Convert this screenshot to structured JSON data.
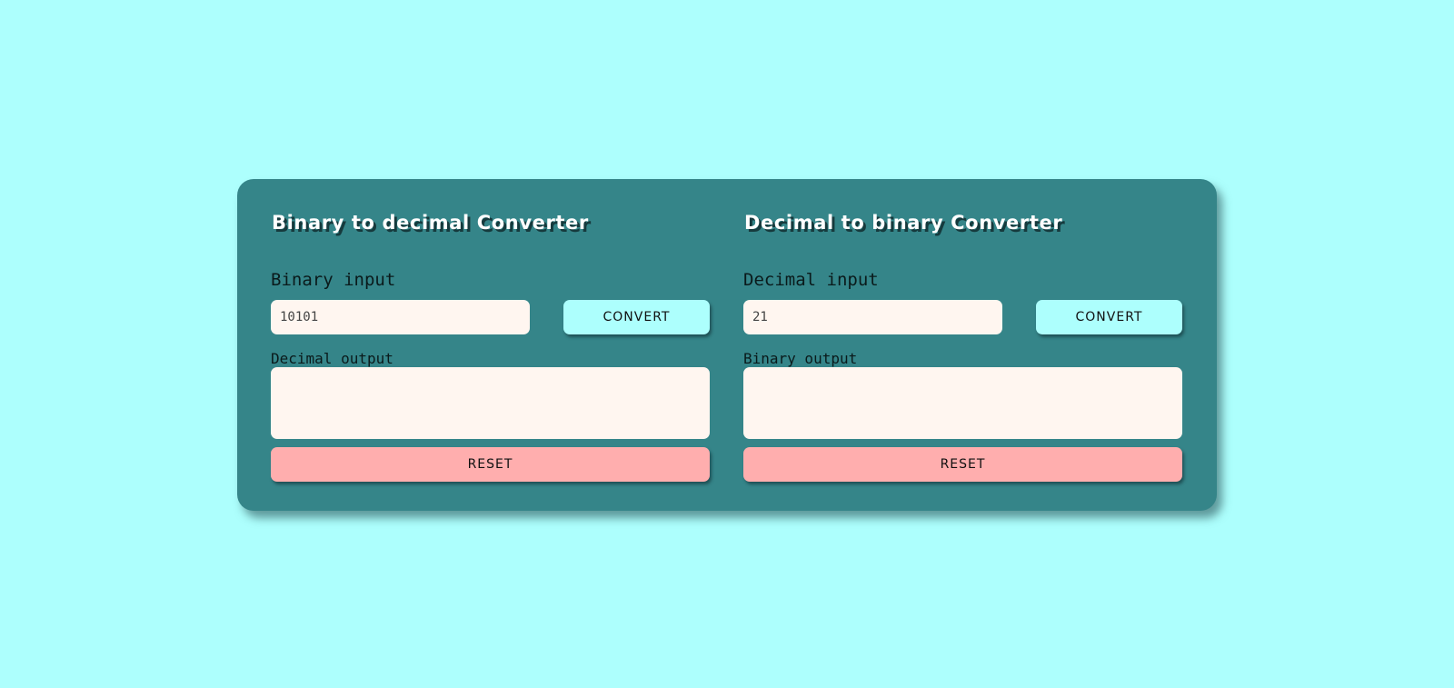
{
  "colors": {
    "page_background": "#adfffd",
    "card_background": "#358589",
    "field_background": "#fff6f0",
    "convert_button": "#adfffd",
    "reset_button": "#ffaeae",
    "title_text": "#ffffff"
  },
  "binary_to_decimal": {
    "title": "Binary to decimal Converter",
    "input_label": "Binary input",
    "input_value": "10101",
    "convert_label": "CONVERT",
    "output_label": "Decimal output",
    "output_value": "",
    "reset_label": "RESET"
  },
  "decimal_to_binary": {
    "title": "Decimal to binary Converter",
    "input_label": "Decimal input",
    "input_value": "21",
    "convert_label": "CONVERT",
    "output_label": "Binary output",
    "output_value": "",
    "reset_label": "RESET"
  }
}
